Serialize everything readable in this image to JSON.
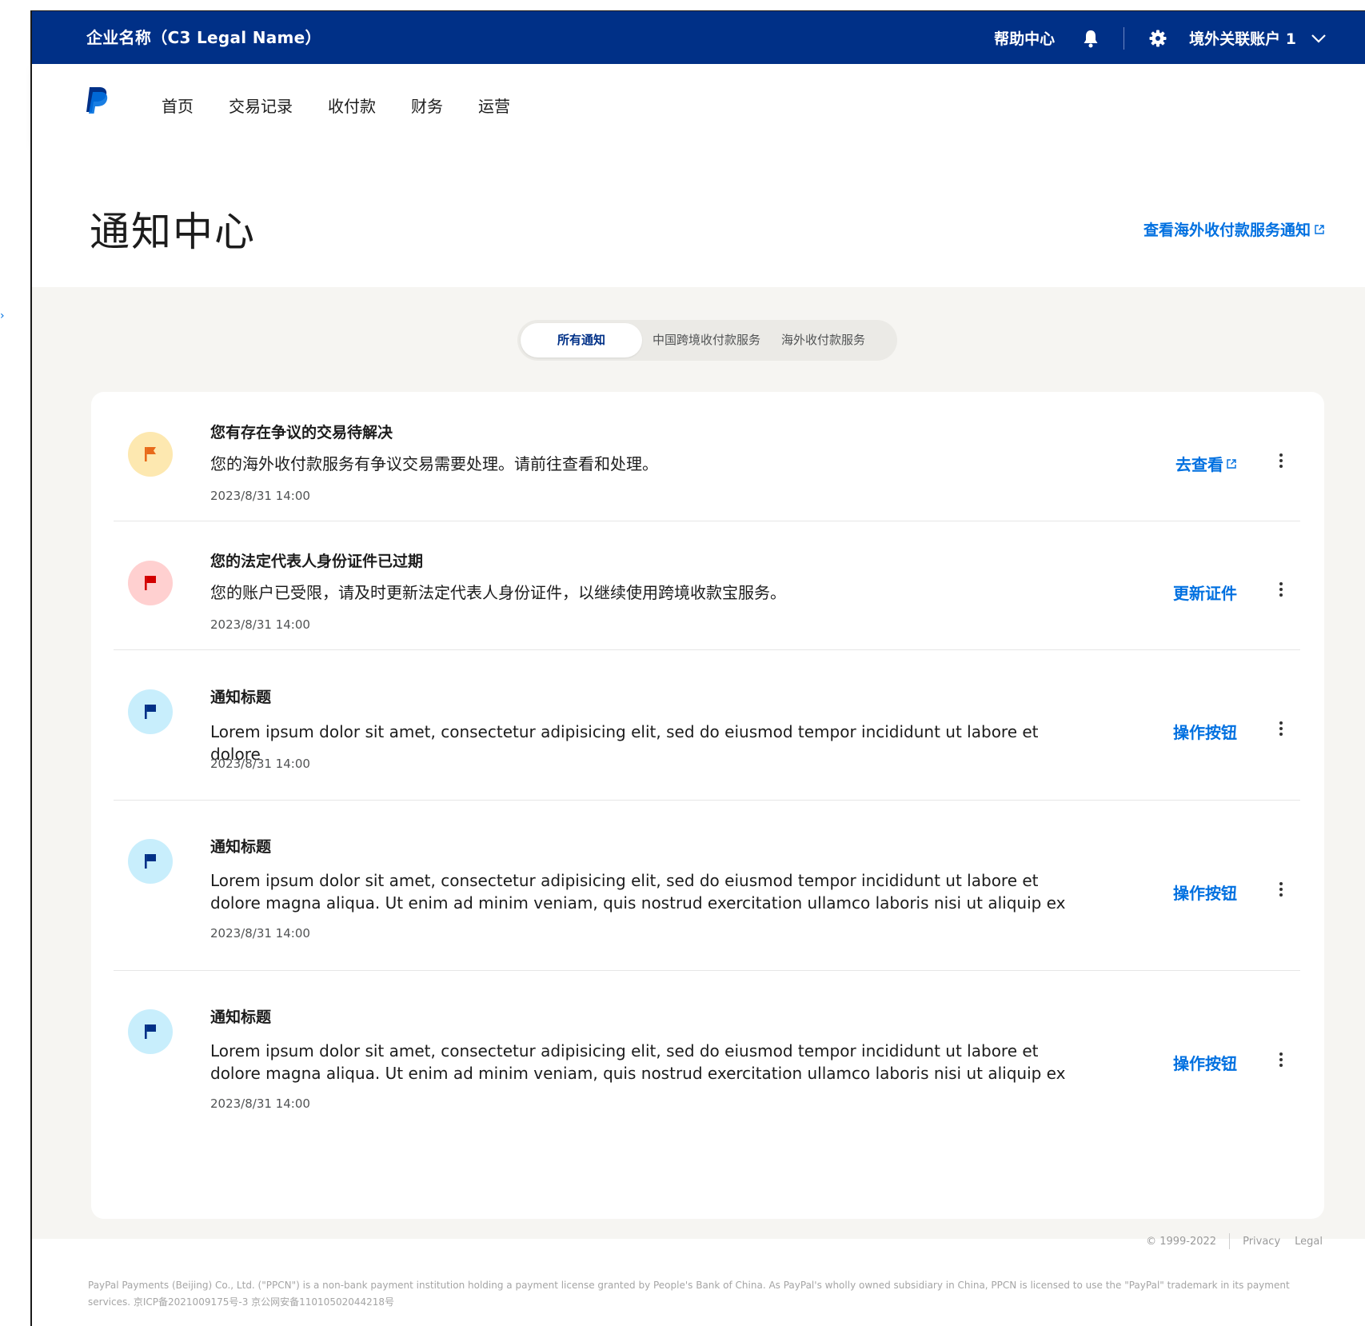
{
  "topbar": {
    "company": "企业名称（C3 Legal Name）",
    "help": "帮助中心",
    "account": "境外关联账户 1"
  },
  "nav": {
    "items": [
      {
        "label": "首页"
      },
      {
        "label": "交易记录"
      },
      {
        "label": "收付款"
      },
      {
        "label": "财务"
      },
      {
        "label": "运营"
      }
    ]
  },
  "page": {
    "title": "通知中心",
    "overseas_link": "查看海外收付款服务通知"
  },
  "tabs": [
    {
      "label": "所有通知",
      "active": true
    },
    {
      "label": "中国跨境收付款服务",
      "active": false
    },
    {
      "label": "海外收付款服务",
      "active": false
    }
  ],
  "notifications": [
    {
      "title": "您有存在争议的交易待解决",
      "desc": "您的海外收付款服务有争议交易需要处理。请前往查看和处理。",
      "time": "2023/8/31 14:00",
      "action": "去查看",
      "icon": "flag-icon",
      "icon_color": "#e86a1a",
      "bg_color": "#fde8b0"
    },
    {
      "title": "您的法定代表人身份证件已过期",
      "desc": "您的账户已受限，请及时更新法定代表人身份证件，以继续使用跨境收款宝服务。",
      "time": "2023/8/31 14:00",
      "action": "更新证件",
      "icon": "flag-icon",
      "icon_color": "#d20000",
      "bg_color": "#ffd0d0"
    },
    {
      "title": "通知标题",
      "desc": "Lorem ipsum dolor sit amet, consectetur adipisicing elit, sed do eiusmod tempor incididunt ut labore et dolore",
      "time": "2023/8/31 14:00",
      "action": "操作按钮",
      "icon": "flag-icon",
      "icon_color": "#003087",
      "bg_color": "#c8eefc"
    },
    {
      "title": "通知标题",
      "desc": "Lorem ipsum dolor sit amet, consectetur adipisicing elit, sed do eiusmod tempor incididunt ut labore et dolore magna aliqua. Ut enim ad minim veniam, quis nostrud exercitation ullamco laboris nisi ut aliquip ex",
      "time": "2023/8/31 14:00",
      "action": "操作按钮",
      "icon": "flag-icon",
      "icon_color": "#003087",
      "bg_color": "#c8eefc"
    },
    {
      "title": "通知标题",
      "desc": "Lorem ipsum dolor sit amet, consectetur adipisicing elit, sed do eiusmod tempor incididunt ut labore et dolore magna aliqua. Ut enim ad minim veniam, quis nostrud exercitation ullamco laboris nisi ut aliquip ex",
      "time": "2023/8/31 14:00",
      "action": "操作按钮",
      "icon": "flag-icon",
      "icon_color": "#003087",
      "bg_color": "#c8eefc"
    }
  ],
  "footer": {
    "copyright": "© 1999-2022",
    "privacy": "Privacy",
    "legal": "Legal",
    "legal_text": "PayPal Payments (Beijing) Co., Ltd. (\"PPCN\") is a non-bank payment institution holding a payment license granted by People's Bank of China. As PayPal's wholly owned subsidiary in China, PPCN is licensed to use the \"PayPal\" trademark in its payment services. 京ICP备2021009175号-3  京公网安备11010502044218号"
  },
  "colors": {
    "brand_navy": "#003087",
    "link_blue": "#0070e0",
    "page_gray": "#f6f5f2"
  }
}
